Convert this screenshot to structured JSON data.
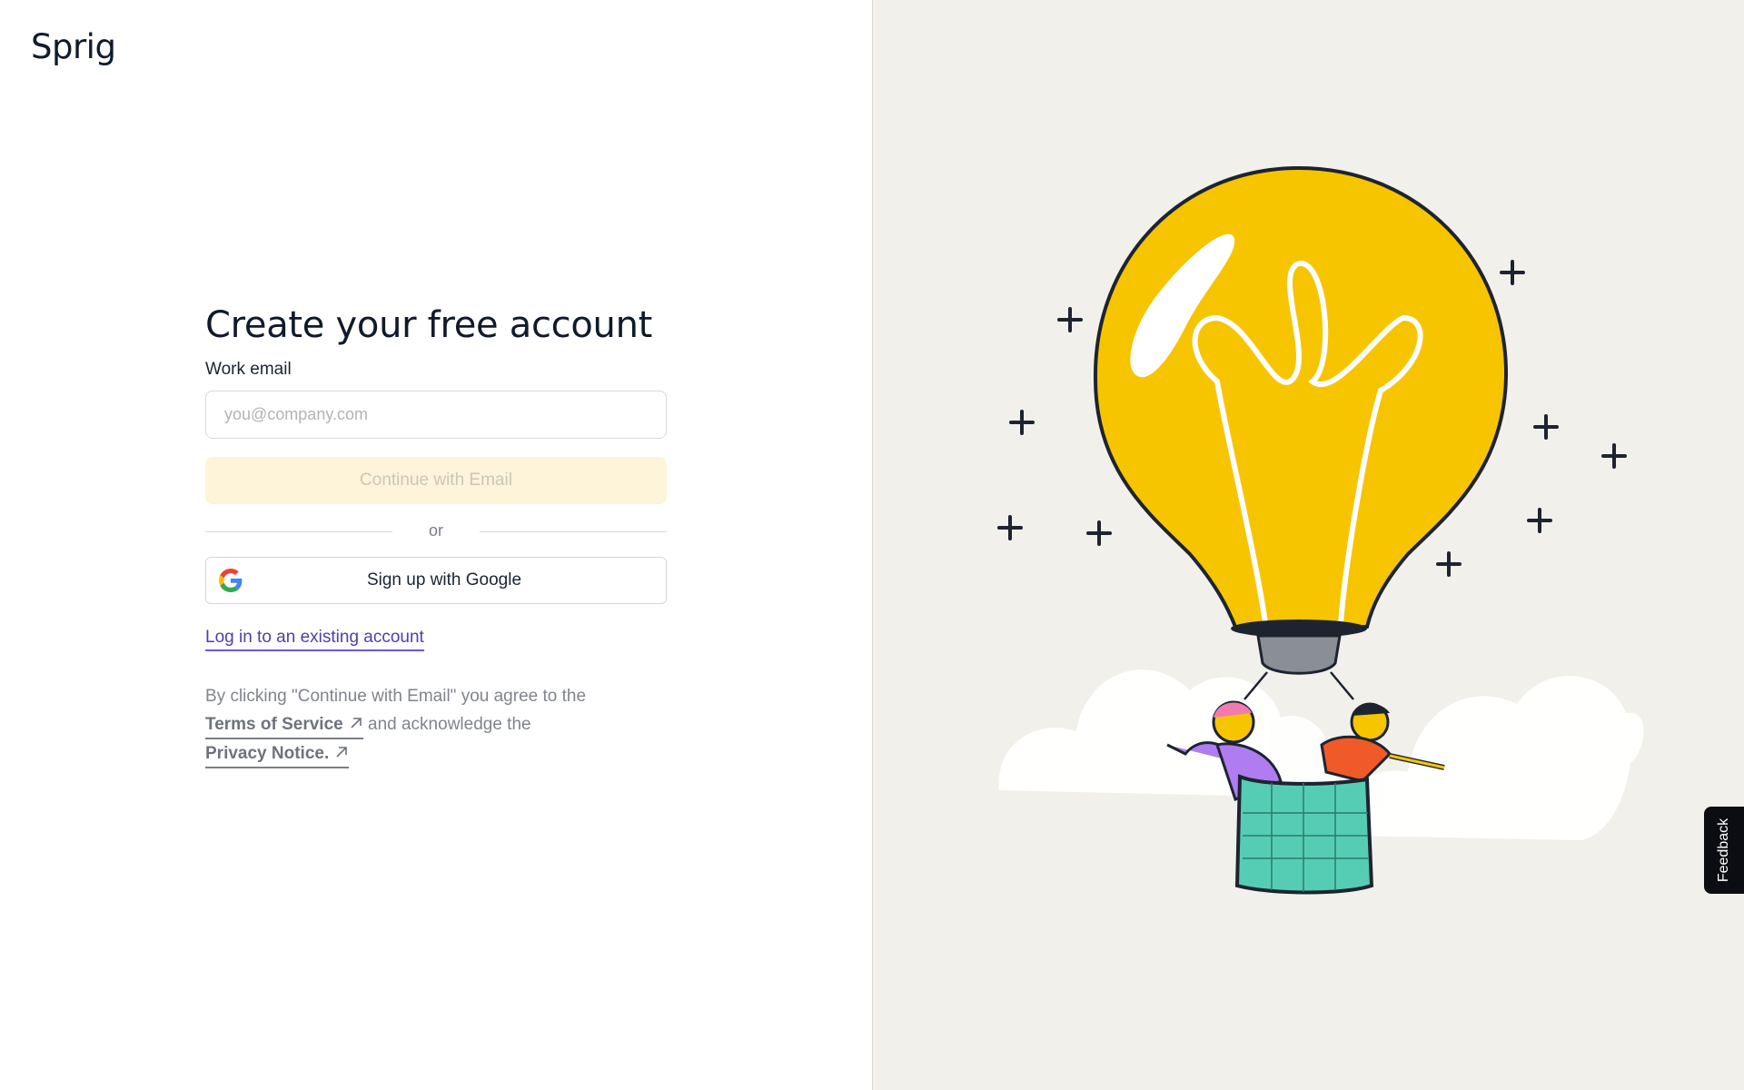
{
  "brand": {
    "logo_text": "Sprig"
  },
  "signup": {
    "title": "Create your free account",
    "email_label": "Work email",
    "email_placeholder": "you@company.com",
    "email_value": "",
    "continue_label": "Continue with Email",
    "divider_text": "or",
    "google_label": "Sign up with Google",
    "google_icon": "google-g-icon",
    "login_link": "Log in to an existing account"
  },
  "legal": {
    "prefix": "By clicking \"Continue with Email\" you agree to the",
    "terms_label": "Terms of Service",
    "middle": "and acknowledge the",
    "privacy_label": "Privacy Notice.",
    "link_icon": "arrow-up-right-icon"
  },
  "feedback": {
    "label": "Feedback"
  },
  "colors": {
    "title_text": "#101a2a",
    "link_accent": "#4f3fa8",
    "continue_disabled_bg": "#fdf4d9",
    "illustration_bg": "#f2f0eb",
    "bulb_yellow": "#f6c500",
    "feedback_bg": "#0b0d12"
  }
}
